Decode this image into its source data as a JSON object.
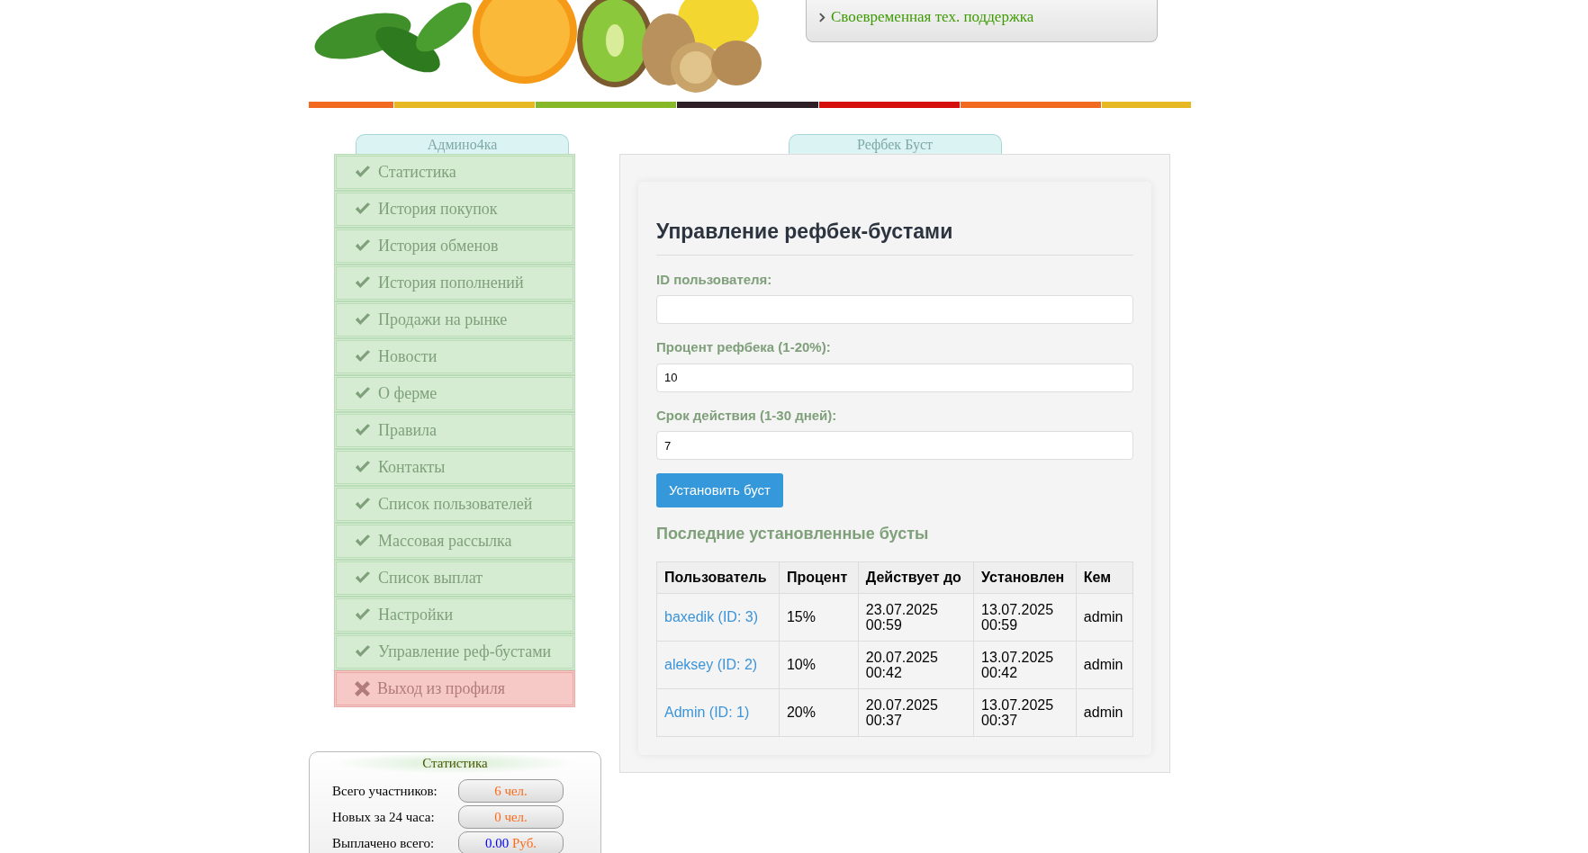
{
  "header": {
    "features": [
      "Своевременная тех. поддержка"
    ]
  },
  "sidebar": {
    "tab": "Админо4ка",
    "items": [
      {
        "label": "Статистика",
        "kind": "link"
      },
      {
        "label": "История покупок",
        "kind": "link"
      },
      {
        "label": "История обменов",
        "kind": "link"
      },
      {
        "label": "История пополнений",
        "kind": "link"
      },
      {
        "label": "Продажи на рынке",
        "kind": "link"
      },
      {
        "label": "Новости",
        "kind": "link"
      },
      {
        "label": "О ферме",
        "kind": "link"
      },
      {
        "label": "Правила",
        "kind": "link"
      },
      {
        "label": "Контакты",
        "kind": "link"
      },
      {
        "label": "Список пользователей",
        "kind": "link"
      },
      {
        "label": "Массовая рассылка",
        "kind": "link"
      },
      {
        "label": "Список выплат",
        "kind": "link"
      },
      {
        "label": "Настройки",
        "kind": "link"
      },
      {
        "label": "Управление реф-бустами",
        "kind": "link"
      },
      {
        "label": "Выход из профиля",
        "kind": "logout"
      }
    ]
  },
  "stats": {
    "title": "Статистика",
    "rows": [
      {
        "label": "Всего участников:",
        "kind": "count",
        "value": "6 чел."
      },
      {
        "label": "Новых за 24 часа:",
        "kind": "count",
        "value": "0 чел."
      },
      {
        "label": "Выплачено всего:",
        "kind": "money",
        "amount": "0.00",
        "unit": "Руб."
      }
    ]
  },
  "panel": {
    "tab": "Рефбек Буст",
    "heading": "Управление рефбек-бустами",
    "fields": [
      {
        "label": "ID пользователя:"
      },
      {
        "label": "Процент рефбека (1-20%):",
        "value": "10"
      },
      {
        "label": "Срок действия (1-30 дней):",
        "value": "7"
      }
    ],
    "submit": "Установить буст",
    "recent_title": "Последние установленные бусты",
    "table": {
      "columns": [
        "Пользователь",
        "Процент",
        "Действует до",
        "Установлен",
        "Кем"
      ],
      "rows": [
        {
          "user": "baxedik (ID: 3)",
          "percent": "15%",
          "until": [
            "23.07.2025",
            "00:59"
          ],
          "set": [
            "13.07.2025",
            "00:59"
          ],
          "by": "admin"
        },
        {
          "user": "aleksey (ID: 2)",
          "percent": "10%",
          "until": [
            "20.07.2025",
            "00:42"
          ],
          "set": [
            "13.07.2025",
            "00:42"
          ],
          "by": "admin"
        },
        {
          "user": "Admin (ID: 1)",
          "percent": "20%",
          "until": [
            "20.07.2025",
            "00:37"
          ],
          "set": [
            "13.07.2025",
            "00:37"
          ],
          "by": "admin"
        }
      ]
    }
  }
}
